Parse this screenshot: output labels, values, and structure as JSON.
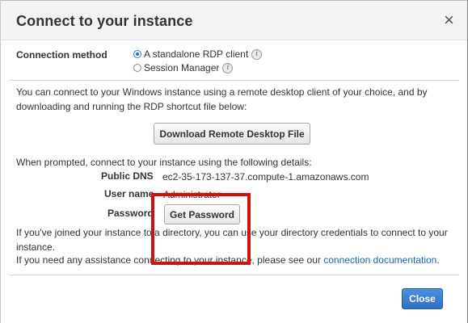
{
  "dialog": {
    "title": "Connect to your instance",
    "close_glyph": "×"
  },
  "connection_method": {
    "label": "Connection method",
    "options": [
      {
        "label": "A standalone RDP client",
        "selected": true
      },
      {
        "label": "Session Manager",
        "selected": false
      }
    ],
    "info_glyph": "i"
  },
  "intro": {
    "line1": "You can connect to your Windows instance using a remote desktop client of your choice, and by",
    "line2": "downloading and running the RDP shortcut file below:"
  },
  "download_button": "Download Remote Desktop File",
  "details": {
    "prompt": "When prompted, connect to your instance using the following details:",
    "public_dns_label": "Public DNS",
    "public_dns_value": "ec2-35-173-137-37.compute-1.amazonaws.com",
    "user_name_label": "User name",
    "user_name_value": "Administrator",
    "password_label": "Password",
    "get_password_button": "Get Password"
  },
  "directory_note": {
    "line1": "If you've joined your instance to a directory, you can use your directory credentials to connect to your",
    "line2": "instance."
  },
  "assistance": {
    "text": "If you need any assistance connecting to your instance, please see our",
    "link": "connection documentation",
    "suffix": "."
  },
  "footer": {
    "close_button": "Close"
  },
  "colors": {
    "highlight": "#cc1111",
    "primary": "#2f6fc0",
    "link": "#1a64b5"
  }
}
